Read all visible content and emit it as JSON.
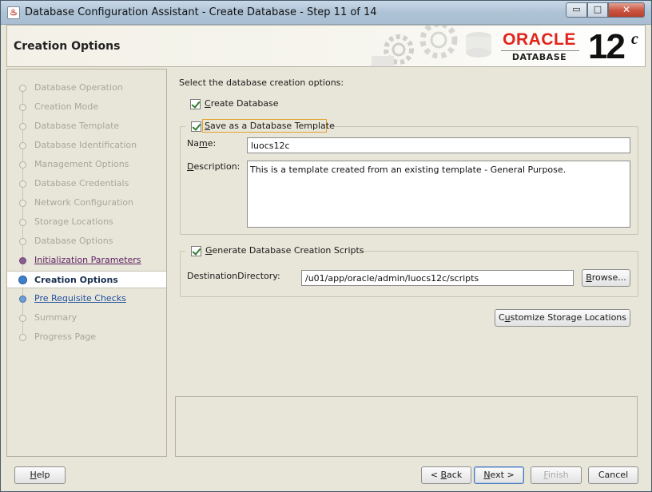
{
  "window": {
    "title": "Database Configuration Assistant - Create Database - Step 11 of 14",
    "icon": "java-cup-icon",
    "controls": {
      "minimize": "▭",
      "maximize": "□",
      "close": "✕"
    }
  },
  "header": {
    "title": "Creation Options",
    "logo_brand": "ORACLE",
    "logo_product": "DATABASE",
    "logo_version": "12",
    "logo_version_sup": "c"
  },
  "nav": {
    "items": [
      {
        "label": "Database Operation",
        "state": "disabled"
      },
      {
        "label": "Creation Mode",
        "state": "disabled"
      },
      {
        "label": "Database Template",
        "state": "disabled"
      },
      {
        "label": "Database Identification",
        "state": "disabled"
      },
      {
        "label": "Management Options",
        "state": "disabled"
      },
      {
        "label": "Database Credentials",
        "state": "disabled"
      },
      {
        "label": "Network Configuration",
        "state": "disabled"
      },
      {
        "label": "Storage Locations",
        "state": "disabled"
      },
      {
        "label": "Database Options",
        "state": "disabled"
      },
      {
        "label": "Initialization Parameters",
        "state": "visited"
      },
      {
        "label": "Creation Options",
        "state": "current"
      },
      {
        "label": "Pre Requisite Checks",
        "state": "next"
      },
      {
        "label": "Summary",
        "state": "disabled"
      },
      {
        "label": "Progress Page",
        "state": "disabled"
      }
    ]
  },
  "main": {
    "prompt": "Select the database creation options:",
    "create_database": {
      "mnemonic": "C",
      "rest": "reate Database",
      "checked": true
    },
    "save_template": {
      "mnemonic": "S",
      "rest": "ave as a Database Template",
      "checked": true,
      "name_label_pre": "Na",
      "name_label_mn": "m",
      "name_label_post": "e:",
      "name_value": "luocs12c",
      "desc_label_mn": "D",
      "desc_label_post": "escription:",
      "desc_value": "This is a template created from an existing template - General Purpose."
    },
    "generate_scripts": {
      "mnemonic": "G",
      "rest": "enerate Database Creation Scripts",
      "checked": true,
      "dest_label": "DestinationDirectory:",
      "dest_value": "/u01/app/oracle/admin/luocs12c/scripts",
      "browse_mn": "B",
      "browse_rest": "rowse..."
    },
    "customize_storage": {
      "mnemonic": "u",
      "pre": "C",
      "rest": "stomize Storage Locations"
    }
  },
  "footer": {
    "help": {
      "mnemonic": "H",
      "rest": "elp"
    },
    "back": {
      "pre": "< ",
      "mnemonic": "B",
      "rest": "ack"
    },
    "next": {
      "mnemonic": "N",
      "rest": "ext >"
    },
    "finish": {
      "mnemonic": "F",
      "rest": "inish",
      "enabled": false
    },
    "cancel": "Cancel"
  },
  "colors": {
    "oracle_red": "#e2231a",
    "nav_current": "#3f7fcb",
    "nav_visited": "#5e2164",
    "check_green": "#2f7d2f"
  }
}
